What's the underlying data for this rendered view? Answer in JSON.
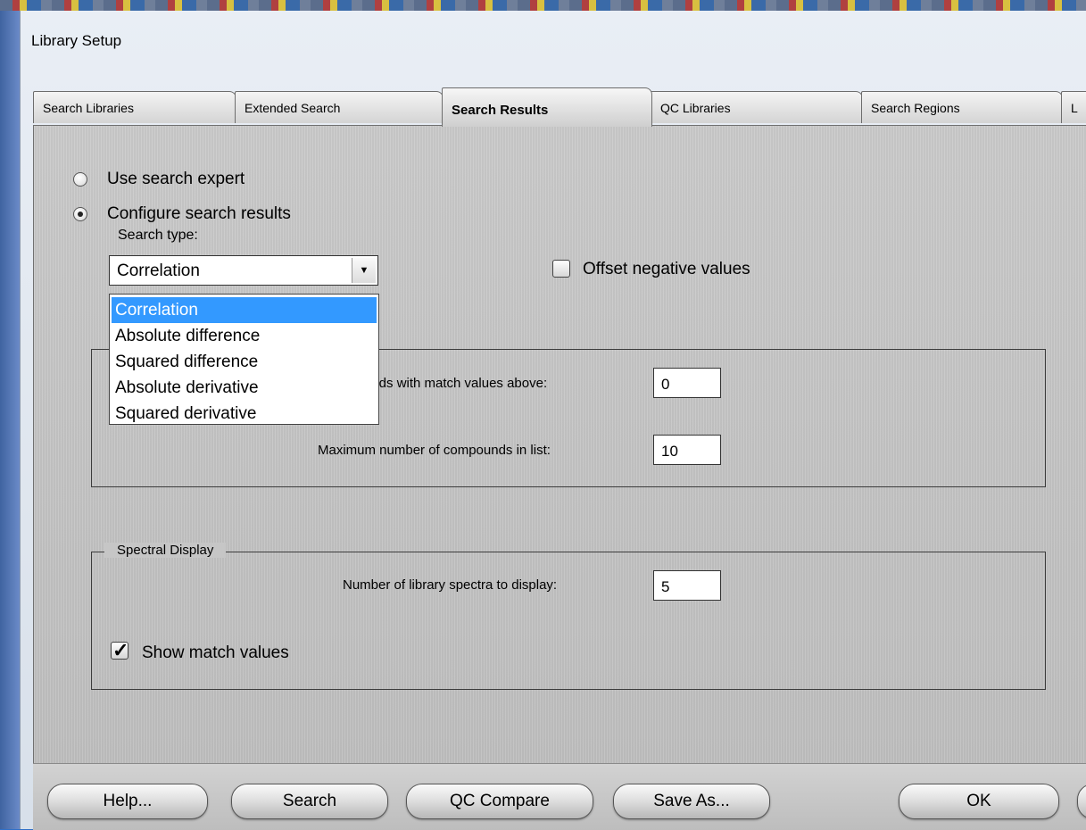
{
  "window": {
    "title": "Library Setup"
  },
  "tabs": [
    {
      "label": "Search Libraries"
    },
    {
      "label": "Extended Search"
    },
    {
      "label": "Search Results"
    },
    {
      "label": "QC Libraries"
    },
    {
      "label": "Search Regions"
    },
    {
      "label": "L"
    }
  ],
  "mode": {
    "use_expert_label": "Use search expert",
    "configure_label": "Configure search results",
    "selected": "Configure search results"
  },
  "search_type": {
    "label": "Search type:",
    "value": "Correlation",
    "options": [
      "Correlation",
      "Absolute difference",
      "Squared difference",
      "Absolute derivative",
      "Squared derivative"
    ]
  },
  "offset_negative": {
    "label": "Offset negative values",
    "checked": false
  },
  "match_limits": {
    "min_match_label": "unds with match values above:",
    "min_match_value": "0",
    "max_compounds_label": "Maximum number of compounds in list:",
    "max_compounds_value": "10"
  },
  "spectral_display": {
    "title": "Spectral Display",
    "num_spectra_label": "Number of library spectra to display:",
    "num_spectra_value": "5",
    "show_match_label": "Show match values",
    "show_match_checked": true
  },
  "buttons": {
    "help": "Help...",
    "search": "Search",
    "qc_compare": "QC Compare",
    "save_as": "Save As...",
    "ok": "OK"
  }
}
